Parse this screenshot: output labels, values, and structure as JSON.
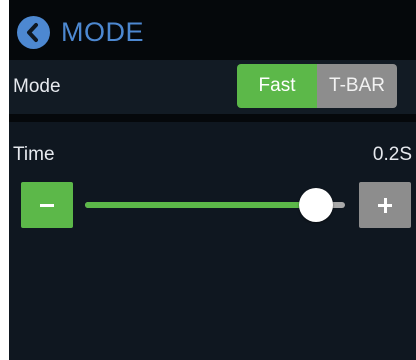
{
  "header": {
    "title": "MODE",
    "back_icon": "chevron-left-icon",
    "title_color": "#4d88d1"
  },
  "mode_row": {
    "label": "Mode",
    "options": [
      "Fast",
      "T-BAR"
    ],
    "selected": "Fast",
    "selected_color": "#5cb849",
    "unselected_color": "#8d8d8d"
  },
  "time_setting": {
    "label": "Time",
    "value": "0.2S",
    "minus_icon": "minus-icon",
    "plus_icon": "plus-icon",
    "slider_position": 0.89,
    "accent_color": "#5cb849"
  }
}
